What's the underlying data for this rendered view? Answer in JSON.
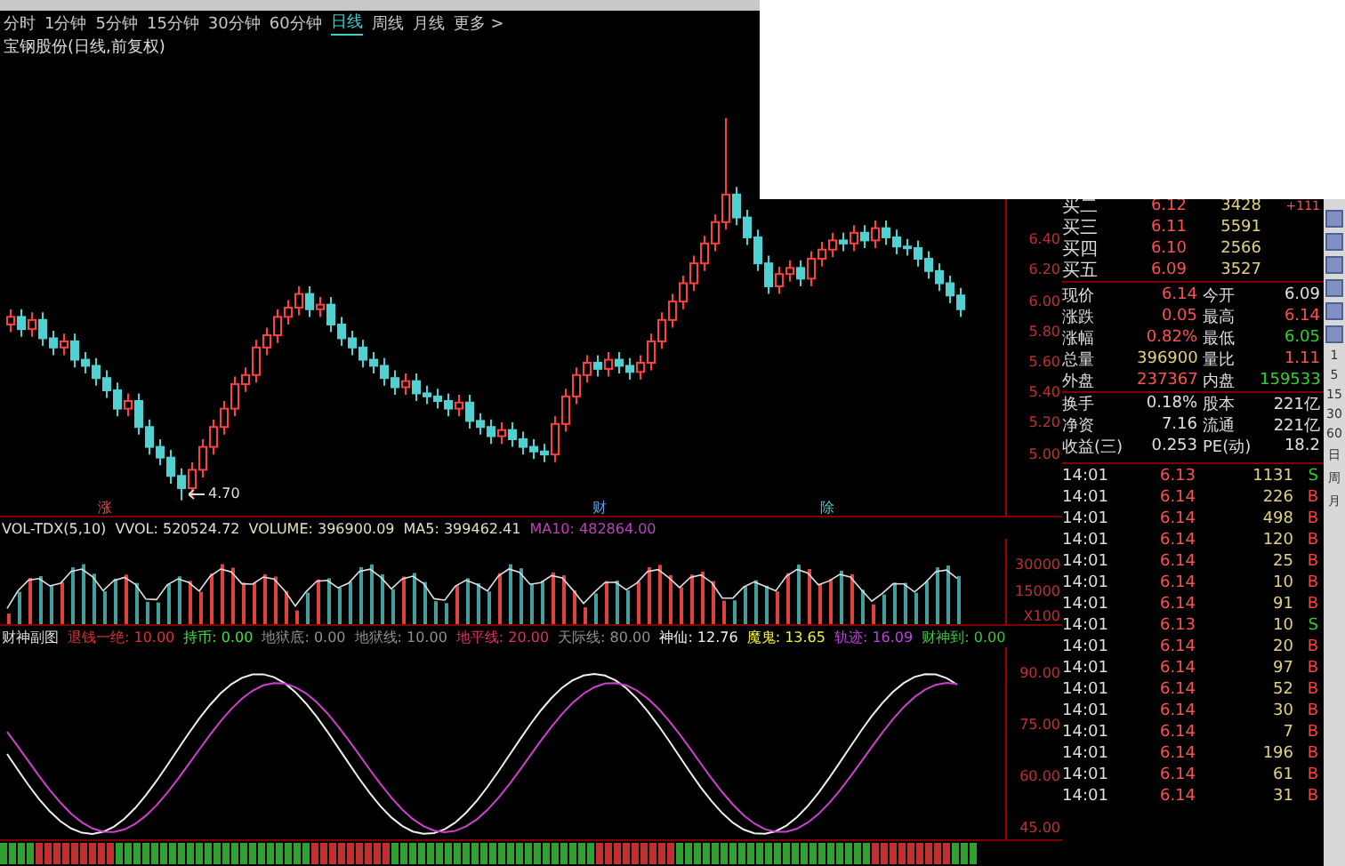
{
  "tabs": [
    {
      "label": "分时",
      "selected": false
    },
    {
      "label": "1分钟",
      "selected": false
    },
    {
      "label": "5分钟",
      "selected": false
    },
    {
      "label": "15分钟",
      "selected": false
    },
    {
      "label": "30分钟",
      "selected": false
    },
    {
      "label": "60分钟",
      "selected": false
    },
    {
      "label": "日线",
      "selected": true
    },
    {
      "label": "周线",
      "selected": false
    },
    {
      "label": "月线",
      "selected": false
    },
    {
      "label": "更多 >",
      "selected": false
    }
  ],
  "chart_title": "宝钢股份(日线,前复权)",
  "main_chart": {
    "chart_data": {
      "type": "candlestick",
      "ylim": [
        4.6,
        7.6
      ],
      "yticks": [
        {
          "value": 6.4,
          "label": "6.40"
        },
        {
          "value": 6.2,
          "label": "6.20"
        },
        {
          "value": 6.0,
          "label": "6.00"
        },
        {
          "value": 5.8,
          "label": "5.80"
        },
        {
          "value": 5.6,
          "label": "5.60"
        },
        {
          "value": 5.4,
          "label": "5.40"
        },
        {
          "value": 5.2,
          "label": "5.20"
        },
        {
          "value": 5.0,
          "label": "5.00"
        }
      ],
      "ohlc": [
        [
          5.85,
          5.95,
          5.8,
          5.9
        ],
        [
          5.9,
          5.95,
          5.77,
          5.82
        ],
        [
          5.82,
          5.93,
          5.77,
          5.88
        ],
        [
          5.88,
          5.93,
          5.71,
          5.76
        ],
        [
          5.76,
          5.81,
          5.65,
          5.7
        ],
        [
          5.7,
          5.79,
          5.65,
          5.74
        ],
        [
          5.74,
          5.79,
          5.57,
          5.62
        ],
        [
          5.62,
          5.67,
          5.53,
          5.58
        ],
        [
          5.58,
          5.63,
          5.45,
          5.5
        ],
        [
          5.5,
          5.55,
          5.37,
          5.42
        ],
        [
          5.42,
          5.47,
          5.25,
          5.3
        ],
        [
          5.3,
          5.4,
          5.25,
          5.35
        ],
        [
          5.35,
          5.4,
          5.13,
          5.18
        ],
        [
          5.18,
          5.23,
          5.0,
          5.05
        ],
        [
          5.05,
          5.1,
          4.93,
          4.98
        ],
        [
          4.98,
          5.03,
          4.81,
          4.86
        ],
        [
          4.86,
          4.91,
          4.7,
          4.78
        ],
        [
          4.78,
          4.95,
          4.73,
          4.9
        ],
        [
          4.9,
          5.1,
          4.85,
          5.05
        ],
        [
          5.05,
          5.23,
          5.0,
          5.18
        ],
        [
          5.18,
          5.35,
          5.13,
          5.3
        ],
        [
          5.3,
          5.51,
          5.25,
          5.46
        ],
        [
          5.46,
          5.57,
          5.41,
          5.52
        ],
        [
          5.52,
          5.75,
          5.47,
          5.7
        ],
        [
          5.7,
          5.83,
          5.65,
          5.78
        ],
        [
          5.78,
          5.95,
          5.73,
          5.9
        ],
        [
          5.9,
          6.01,
          5.85,
          5.96
        ],
        [
          5.96,
          6.1,
          5.91,
          6.05
        ],
        [
          6.05,
          6.1,
          5.9,
          5.95
        ],
        [
          5.95,
          6.03,
          5.9,
          5.98
        ],
        [
          5.98,
          6.03,
          5.8,
          5.85
        ],
        [
          5.85,
          5.9,
          5.71,
          5.76
        ],
        [
          5.76,
          5.81,
          5.65,
          5.7
        ],
        [
          5.7,
          5.75,
          5.57,
          5.62
        ],
        [
          5.62,
          5.67,
          5.53,
          5.58
        ],
        [
          5.58,
          5.63,
          5.45,
          5.5
        ],
        [
          5.5,
          5.55,
          5.39,
          5.44
        ],
        [
          5.44,
          5.53,
          5.39,
          5.48
        ],
        [
          5.48,
          5.53,
          5.35,
          5.4
        ],
        [
          5.4,
          5.45,
          5.33,
          5.38
        ],
        [
          5.38,
          5.43,
          5.3,
          5.35
        ],
        [
          5.35,
          5.4,
          5.25,
          5.3
        ],
        [
          5.3,
          5.39,
          5.25,
          5.34
        ],
        [
          5.34,
          5.39,
          5.17,
          5.22
        ],
        [
          5.22,
          5.27,
          5.13,
          5.18
        ],
        [
          5.18,
          5.23,
          5.07,
          5.12
        ],
        [
          5.12,
          5.21,
          5.07,
          5.16
        ],
        [
          5.16,
          5.21,
          5.05,
          5.1
        ],
        [
          5.1,
          5.15,
          5.0,
          5.05
        ],
        [
          5.05,
          5.1,
          4.97,
          5.02
        ],
        [
          5.02,
          5.07,
          4.95,
          5.0
        ],
        [
          5.0,
          5.25,
          4.95,
          5.2
        ],
        [
          5.2,
          5.43,
          5.15,
          5.38
        ],
        [
          5.38,
          5.57,
          5.33,
          5.52
        ],
        [
          5.52,
          5.65,
          5.47,
          5.6
        ],
        [
          5.6,
          5.65,
          5.51,
          5.56
        ],
        [
          5.56,
          5.67,
          5.51,
          5.62
        ],
        [
          5.62,
          5.67,
          5.53,
          5.58
        ],
        [
          5.58,
          5.63,
          5.49,
          5.54
        ],
        [
          5.54,
          5.65,
          5.49,
          5.6
        ],
        [
          5.6,
          5.79,
          5.55,
          5.74
        ],
        [
          5.74,
          5.93,
          5.69,
          5.88
        ],
        [
          5.88,
          6.05,
          5.83,
          6.0
        ],
        [
          6.0,
          6.17,
          5.95,
          6.12
        ],
        [
          6.12,
          6.3,
          6.07,
          6.25
        ],
        [
          6.25,
          6.43,
          6.2,
          6.38
        ],
        [
          6.38,
          6.57,
          6.33,
          6.52
        ],
        [
          6.52,
          7.2,
          6.47,
          6.7
        ],
        [
          6.7,
          6.75,
          6.5,
          6.55
        ],
        [
          6.55,
          6.6,
          6.37,
          6.42
        ],
        [
          6.42,
          6.47,
          6.2,
          6.25
        ],
        [
          6.25,
          6.3,
          6.05,
          6.1
        ],
        [
          6.1,
          6.23,
          6.05,
          6.18
        ],
        [
          6.18,
          6.27,
          6.13,
          6.22
        ],
        [
          6.22,
          6.27,
          6.1,
          6.15
        ],
        [
          6.15,
          6.33,
          6.1,
          6.28
        ],
        [
          6.28,
          6.39,
          6.23,
          6.34
        ],
        [
          6.34,
          6.45,
          6.29,
          6.4
        ],
        [
          6.4,
          6.45,
          6.33,
          6.38
        ],
        [
          6.38,
          6.5,
          6.33,
          6.45
        ],
        [
          6.45,
          6.5,
          6.35,
          6.4
        ],
        [
          6.4,
          6.53,
          6.35,
          6.48
        ],
        [
          6.48,
          6.53,
          6.37,
          6.42
        ],
        [
          6.42,
          6.47,
          6.31,
          6.36
        ],
        [
          6.36,
          6.41,
          6.3,
          6.35
        ],
        [
          6.35,
          6.4,
          6.23,
          6.28
        ],
        [
          6.28,
          6.33,
          6.15,
          6.2
        ],
        [
          6.2,
          6.25,
          6.07,
          6.12
        ],
        [
          6.12,
          6.17,
          5.99,
          6.04
        ],
        [
          6.04,
          6.09,
          5.9,
          5.95
        ]
      ]
    },
    "low_label": "4.70",
    "events": [
      {
        "label": "涨",
        "color": "#e05050"
      },
      {
        "label": "财",
        "color": "#60a0e0"
      },
      {
        "label": "除",
        "color": "#60c0c0"
      }
    ]
  },
  "volume": {
    "legend": [
      {
        "text": "VOL-TDX(5,10)",
        "color": "#e0e0e0"
      },
      {
        "text": "VVOL: 520524.72",
        "color": "#e0e0e0"
      },
      {
        "text": "VOLUME: 396900.09",
        "color": "#e0e0c0"
      },
      {
        "text": "MA5: 399462.41",
        "color": "#e0e0c0"
      },
      {
        "text": "MA10: 482864.00",
        "color": "#c040c0"
      }
    ],
    "axis": [
      "30000",
      "15000",
      "X100"
    ]
  },
  "indicator": {
    "name": "财神副图",
    "legend": [
      {
        "text": "退钱一绝: 10.00",
        "color": "#e03030"
      },
      {
        "text": "持币: 0.00",
        "color": "#40e040"
      },
      {
        "text": "地狱底: 0.00",
        "color": "#909090"
      },
      {
        "text": "地狱线: 10.00",
        "color": "#909090"
      },
      {
        "text": "地平线: 20.00",
        "color": "#e03060"
      },
      {
        "text": "天际线: 80.00",
        "color": "#909090"
      },
      {
        "text": "神仙: 12.76",
        "color": "#f0f0f0"
      },
      {
        "text": "魔鬼: 13.65",
        "color": "#f0f040"
      },
      {
        "text": "轨迹: 16.09",
        "color": "#c040e0"
      },
      {
        "text": "财神到: 0.00",
        "color": "#40c040"
      }
    ],
    "axis": [
      "90.00",
      "75.00",
      "60.00",
      "45.00"
    ]
  },
  "bids": [
    {
      "label": "买二",
      "price": "6.12",
      "volume": "3428",
      "change": "+111"
    },
    {
      "label": "买三",
      "price": "6.11",
      "volume": "5591"
    },
    {
      "label": "买四",
      "price": "6.10",
      "volume": "2566"
    },
    {
      "label": "买五",
      "price": "6.09",
      "volume": "3527"
    }
  ],
  "stats": [
    [
      {
        "label": "现价",
        "value": "6.14",
        "color": "#ff5050"
      },
      {
        "label": "今开",
        "value": "6.09",
        "color": "#e0e0e0"
      }
    ],
    [
      {
        "label": "涨跌",
        "value": "0.05",
        "color": "#ff5050"
      },
      {
        "label": "最高",
        "value": "6.14",
        "color": "#ff5050"
      }
    ],
    [
      {
        "label": "涨幅",
        "value": "0.82%",
        "color": "#ff5050"
      },
      {
        "label": "最低",
        "value": "6.05",
        "color": "#30d030"
      }
    ],
    [
      {
        "label": "总量",
        "value": "396900",
        "color": "#e0d080"
      },
      {
        "label": "量比",
        "value": "1.11",
        "color": "#ff5050"
      }
    ],
    [
      {
        "label": "外盘",
        "value": "237367",
        "color": "#ff5050"
      },
      {
        "label": "内盘",
        "value": "159533",
        "color": "#30d030"
      }
    ],
    [
      {
        "label": "换手",
        "value": "0.18%",
        "color": "#e0e0e0"
      },
      {
        "label": "股本",
        "value": "221亿",
        "color": "#e0e0e0"
      }
    ],
    [
      {
        "label": "净资",
        "value": "7.16",
        "color": "#e0e0e0"
      },
      {
        "label": "流通",
        "value": "221亿",
        "color": "#e0e0e0"
      }
    ],
    [
      {
        "label": "收益(三)",
        "value": "0.253",
        "color": "#e0e0e0"
      },
      {
        "label": "PE(动)",
        "value": "18.2",
        "color": "#e0e0e0"
      }
    ]
  ],
  "trades": [
    {
      "time": "14:01",
      "price": "6.13",
      "volume": "1131",
      "side": "S",
      "color": "#30d030"
    },
    {
      "time": "14:01",
      "price": "6.14",
      "volume": "226",
      "side": "B",
      "color": "#ff4040"
    },
    {
      "time": "14:01",
      "price": "6.14",
      "volume": "498",
      "side": "B",
      "color": "#ff4040"
    },
    {
      "time": "14:01",
      "price": "6.14",
      "volume": "120",
      "side": "B",
      "color": "#ff4040"
    },
    {
      "time": "14:01",
      "price": "6.14",
      "volume": "25",
      "side": "B",
      "color": "#ff4040"
    },
    {
      "time": "14:01",
      "price": "6.14",
      "volume": "10",
      "side": "B",
      "color": "#ff4040"
    },
    {
      "time": "14:01",
      "price": "6.14",
      "volume": "91",
      "side": "B",
      "color": "#ff4040"
    },
    {
      "time": "14:01",
      "price": "6.13",
      "volume": "10",
      "side": "S",
      "color": "#30d030"
    },
    {
      "time": "14:01",
      "price": "6.14",
      "volume": "20",
      "side": "B",
      "color": "#ff4040"
    },
    {
      "time": "14:01",
      "price": "6.14",
      "volume": "97",
      "side": "B",
      "color": "#ff4040"
    },
    {
      "time": "14:01",
      "price": "6.14",
      "volume": "52",
      "side": "B",
      "color": "#ff4040"
    },
    {
      "time": "14:01",
      "price": "6.14",
      "volume": "30",
      "side": "B",
      "color": "#ff4040"
    },
    {
      "time": "14:01",
      "price": "6.14",
      "volume": "7",
      "side": "B",
      "color": "#ff4040"
    },
    {
      "time": "14:01",
      "price": "6.14",
      "volume": "196",
      "side": "B",
      "color": "#ff4040"
    },
    {
      "time": "14:01",
      "price": "6.14",
      "volume": "61",
      "side": "B",
      "color": "#ff4040"
    },
    {
      "time": "14:01",
      "price": "6.14",
      "volume": "31",
      "side": "B",
      "color": "#ff4040"
    }
  ],
  "period_buttons": [
    "1",
    "5",
    "15",
    "30",
    "60",
    "日",
    "周",
    "月"
  ]
}
